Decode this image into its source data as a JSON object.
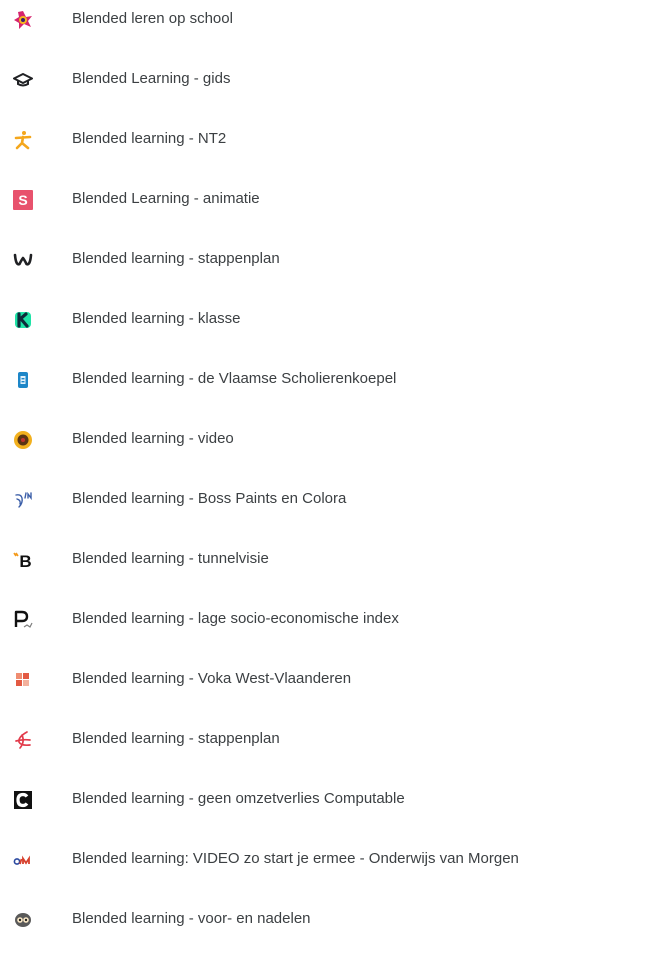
{
  "links": [
    {
      "label": "Blended leren op school",
      "icon": "colorful-flower-icon"
    },
    {
      "label": "Blended Learning - gids",
      "icon": "graduation-cap-icon"
    },
    {
      "label": "Blended learning - NT2",
      "icon": "running-figure-icon"
    },
    {
      "label": "Blended Learning - animatie",
      "icon": "s-logo-icon"
    },
    {
      "label": "Blended learning - stappenplan",
      "icon": "w-logo-icon"
    },
    {
      "label": "Blended learning - klasse",
      "icon": "k-logo-icon"
    },
    {
      "label": "Blended learning - de Vlaamse Scholierenkoepel",
      "icon": "blue-document-icon"
    },
    {
      "label": "Blended learning - video",
      "icon": "sunflower-icon"
    },
    {
      "label": "Blended learning - Boss Paints en Colora",
      "icon": "bird-logo-icon"
    },
    {
      "label": "Blended learning - tunnelvisie",
      "icon": "b-logo-icon"
    },
    {
      "label": "Blended learning - lage socio-economische index",
      "icon": "p-logo-icon"
    },
    {
      "label": "Blended learning - Voka West-Vlaanderen",
      "icon": "vw-logo-icon"
    },
    {
      "label": "Blended learning - stappenplan",
      "icon": "red-swirl-icon"
    },
    {
      "label": "Blended learning - geen omzetverlies Computable",
      "icon": "c-logo-icon"
    },
    {
      "label": "Blended learning: VIDEO zo start je ermee - Onderwijs van Morgen",
      "icon": "ovm-logo-icon"
    },
    {
      "label": "Blended learning - voor- en nadelen",
      "icon": "owl-icon"
    }
  ]
}
